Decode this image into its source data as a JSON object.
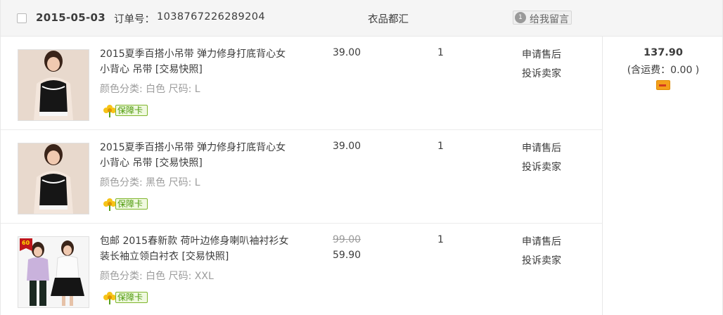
{
  "order": {
    "date": "2015-05-03",
    "order_no_label": "订单号：",
    "order_no": "1038767226289204",
    "shop": "衣品都汇",
    "message_button": "给我留言",
    "message_count": "1"
  },
  "items": [
    {
      "title": "2015夏季百搭小吊带 弹力修身打底背心女 小背心 吊带 [交易快照]",
      "sku": "颜色分类: 白色  尺码: L",
      "badge": "保障卡",
      "price": "39.00",
      "qty": "1",
      "action1": "申请售后",
      "action2": "投诉卖家"
    },
    {
      "title": "2015夏季百搭小吊带 弹力修身打底背心女 小背心 吊带 [交易快照]",
      "sku": "颜色分类: 黑色  尺码: L",
      "badge": "保障卡",
      "price": "39.00",
      "qty": "1",
      "action2": "投诉卖家",
      "action1": "申请售后"
    },
    {
      "title": "包邮 2015春新款 荷叶边修身喇叭袖衬衫女装长袖立领白衬衣 [交易快照]",
      "sku": "颜色分类: 白色  尺码: XXL",
      "badge": "保障卡",
      "price_old": "99.00",
      "price": "59.90",
      "qty": "1",
      "action1": "申请售后",
      "action2": "投诉卖家",
      "thumb_badge": "60"
    }
  ],
  "summary": {
    "total": "137.90",
    "shipping": "(含运费：0.00 )"
  },
  "colors": {
    "header_bg": "#f5f5f5",
    "badge_green": "#4d9a0a",
    "card_orange": "#f4a01b"
  }
}
